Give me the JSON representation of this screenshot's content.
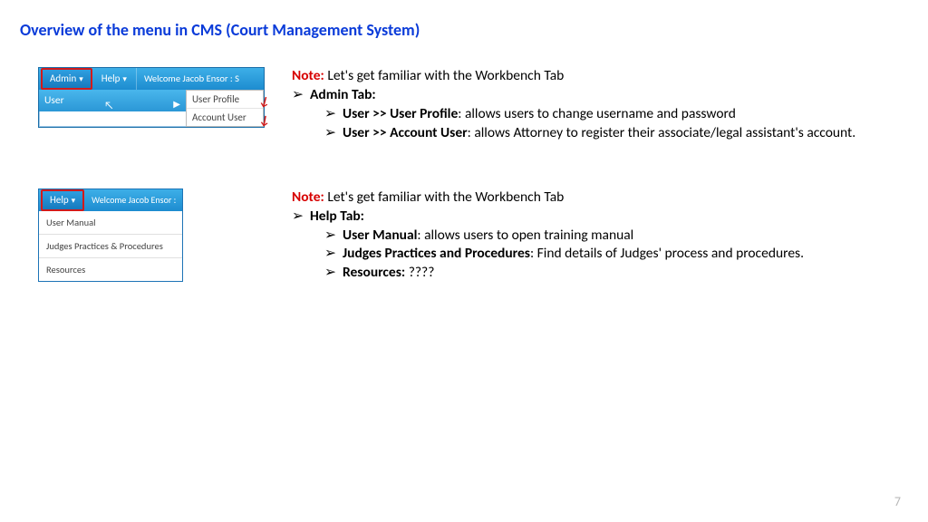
{
  "title": "Overview of the menu in CMS (Court Management System)",
  "page_number": "7",
  "shot1": {
    "admin": "Admin",
    "help": "Help",
    "welcome": "Welcome Jacob Ensor : S",
    "user": "User",
    "fly1": "User Profile",
    "fly2": "Account User"
  },
  "shot2": {
    "help": "Help",
    "welcome": "Welcome Jacob Ensor :",
    "dd1": "User Manual",
    "dd2": "Judges Practices & Procedures",
    "dd3": "Resources"
  },
  "block1": {
    "note_label": "Note:",
    "note_text": " Let's get familiar with the Workbench Tab",
    "l1": "Admin Tab:",
    "l2a_b": "User >> User Profile",
    "l2a_t": ": allows users to change username and password",
    "l2b_b": "User >> Account User",
    "l2b_t": ": allows Attorney to register their associate/legal assistant's account."
  },
  "block2": {
    "note_label": "Note:",
    "note_text": " Let's get familiar with the Workbench Tab",
    "l1": "Help Tab:",
    "l2a_b": "User Manual",
    "l2a_t": ": allows users to open training manual",
    "l2b_b": "Judges Practices and Procedures",
    "l2b_t": ": Find details of Judges' process and procedures.",
    "l2c_b": "Resources:",
    "l2c_t": " ????"
  }
}
